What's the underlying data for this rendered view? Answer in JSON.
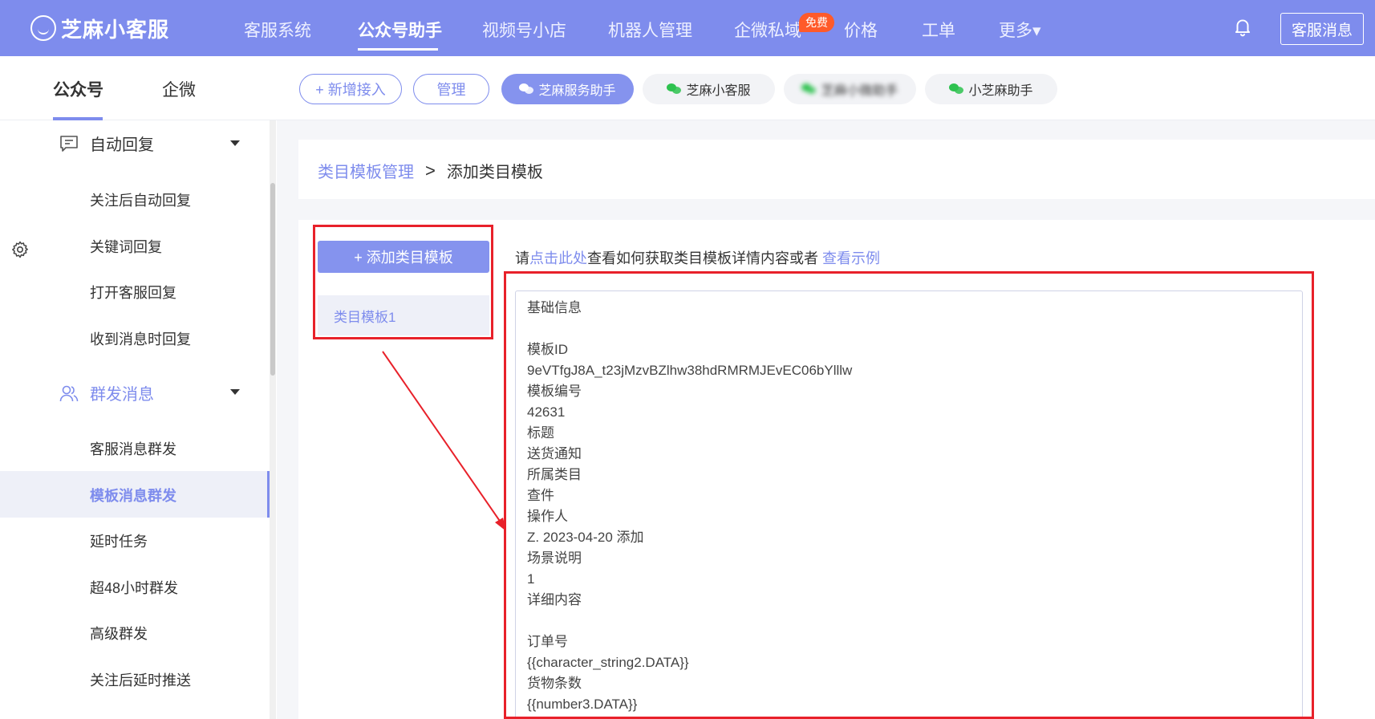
{
  "app": {
    "logo_text": "芝麻小客服"
  },
  "topnav": {
    "items": [
      {
        "label": "客服系统"
      },
      {
        "label": "公众号助手"
      },
      {
        "label": "视频号小店"
      },
      {
        "label": "机器人管理"
      },
      {
        "label": "企微私域"
      },
      {
        "label": "价格"
      },
      {
        "label": "工单"
      },
      {
        "label": "更多▾"
      }
    ],
    "active_index": 1,
    "free_badge": "免费",
    "kefu_button": "客服消息"
  },
  "subtabs": {
    "items": [
      {
        "label": "公众号"
      },
      {
        "label": "企微"
      }
    ],
    "active_index": 0
  },
  "accounts": {
    "add_label": "+ 新增接入",
    "manage_label": "管理",
    "items": [
      {
        "label": "芝麻服务助手",
        "selected": true
      },
      {
        "label": "芝麻小客服",
        "selected": false
      },
      {
        "label": "芝麻小微助手",
        "selected": false,
        "blurred": true
      },
      {
        "label": "小芝麻助手",
        "selected": false
      }
    ]
  },
  "sidebar": {
    "groups": [
      {
        "label": "自动回复",
        "icon": "message-square-icon",
        "items": [
          "关注后自动回复",
          "关键词回复",
          "打开客服回复",
          "收到消息时回复"
        ]
      },
      {
        "label": "群发消息",
        "icon": "users-icon",
        "items": [
          "客服消息群发",
          "模板消息群发",
          "延时任务",
          "超48小时群发",
          "高级群发",
          "关注后延时推送"
        ]
      }
    ],
    "active_item": "模板消息群发"
  },
  "breadcrumb": {
    "parent": "类目模板管理",
    "separator": ">",
    "current": "添加类目模板"
  },
  "template_panel": {
    "add_button": "+ 添加类目模板",
    "items": [
      "类目模板1"
    ]
  },
  "hint": {
    "prefix": "请",
    "link1": "点击此处",
    "middle": "查看如何获取类目模板详情内容或者 ",
    "link2": "查看示例"
  },
  "textarea_lines": [
    "基础信息",
    "",
    "模板ID",
    "9eVTfgJ8A_t23jMzvBZlhw38hdRMRMJEvEC06bYlllw",
    "模板编号",
    "42631",
    "标题",
    "送货通知",
    "所属类目",
    "查件",
    "操作人",
    "Z. 2023-04-20 添加",
    "场景说明",
    "1",
    "详细内容",
    "",
    "订单号",
    "{{character_string2.DATA}}",
    "货物条数",
    "{{number3.DATA}}"
  ],
  "colors": {
    "primary": "#7e8ced",
    "annotation_red": "#e8212a",
    "badge_orange": "#ff5a2a",
    "wechat_green": "#2ec24f"
  }
}
